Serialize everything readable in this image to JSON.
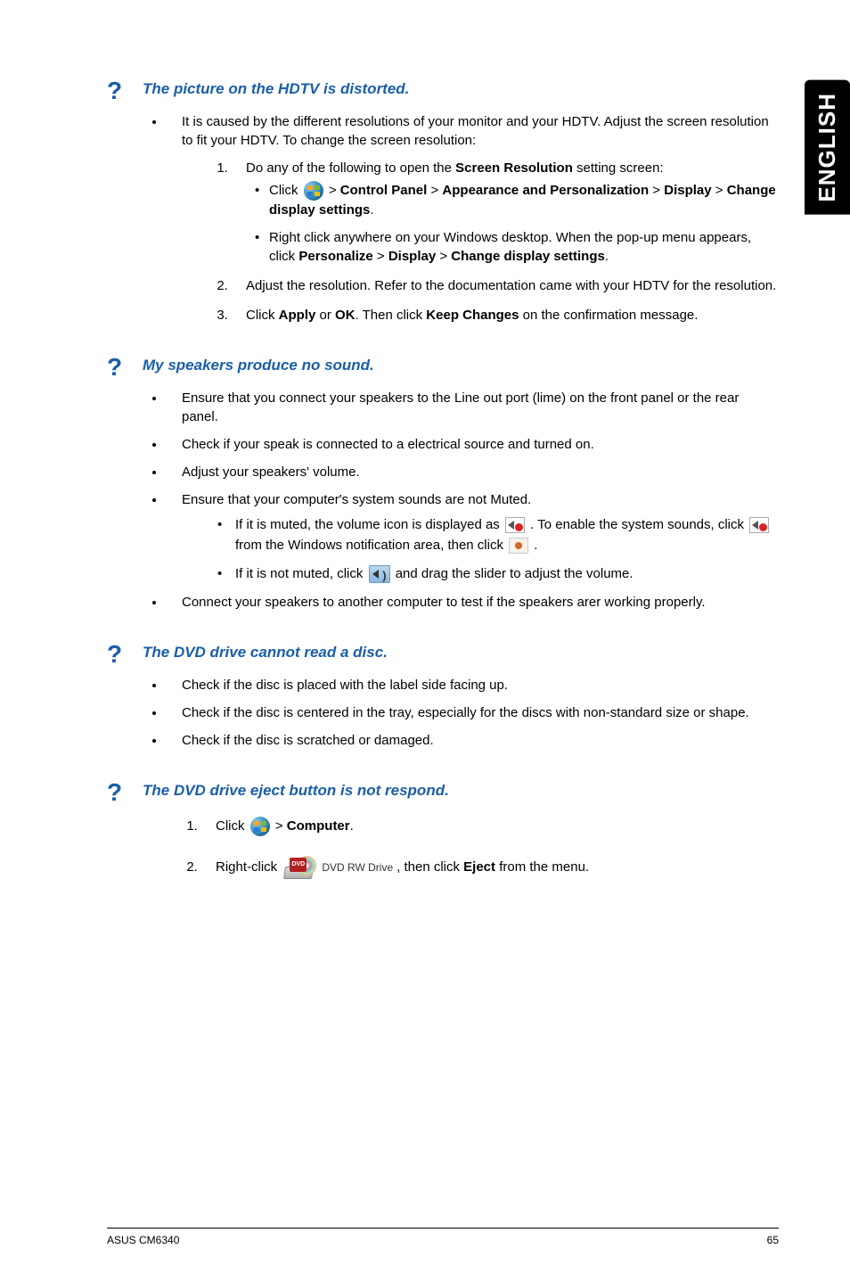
{
  "langTab": "ENGLISH",
  "sections": [
    {
      "title": "The picture on the HDTV is distorted.",
      "bullets": [
        {
          "text": "It is caused by the different resolutions of your monitor and your HDTV. Adjust the screen resolution to fit your HDTV. To change the screen resolution:",
          "steps": [
            {
              "lead": "Do any of the following to open the ",
              "bold1": "Screen Resolution",
              "tail": " setting screen:",
              "subs": [
                {
                  "t1": "Click ",
                  "b1": "Control Panel",
                  "gt1": " > ",
                  "b2": "Appearance and Personalization",
                  "gt2": " > ",
                  "b3": "Display",
                  "gt3": " > ",
                  "b4": "Change display settings",
                  "t2": ".",
                  "hasWinOrb": true
                },
                {
                  "t1": "Right click anywhere on your Windows desktop. When the pop-up menu appears, click ",
                  "b1": "Personalize",
                  "gt1": " > ",
                  "b2": "Display",
                  "gt2": " > ",
                  "b3": "Change display settings",
                  "t2": "."
                }
              ]
            },
            {
              "plain": "Adjust the resolution. Refer to the documentation came with your HDTV for the resolution."
            },
            {
              "t1": "Click ",
              "b1": "Apply",
              "mid": " or ",
              "b2": "OK",
              "t2": ". Then click ",
              "b3": "Keep Changes",
              "t3": " on the confirmation message."
            }
          ]
        }
      ]
    },
    {
      "title": "My speakers produce no sound.",
      "plainBullets": [
        "Ensure that you connect your speakers to the Line out port (lime) on the front panel or the rear panel.",
        "Check if your speak is connected to a electrical source and turned on.",
        "Adjust your speakers' volume."
      ],
      "mutedBullet": {
        "lead": "Ensure that your computer's system sounds are not Muted.",
        "c1a": "If it is muted, the volume icon is displayed as ",
        "c1b": " . To enable the system sounds, click ",
        "c1c": " from the Windows notification area, then click ",
        "c1d": " .",
        "c2a": "If it is not muted, click ",
        "c2b": " and drag the slider to adjust the volume."
      },
      "lastBullet": "Connect your speakers to another computer to test if the speakers arer working properly."
    },
    {
      "title": "The DVD drive cannot read a disc.",
      "plainBullets": [
        "Check if the disc is placed with the label side facing up.",
        "Check if the disc is centered in the tray, especially for the discs with non-standard size or shape.",
        "Check if the disc is scratched or damaged."
      ]
    },
    {
      "title": "The DVD drive eject button is not respond.",
      "steps": [
        {
          "t1": "Click ",
          "b1": "Computer",
          "t2": ".",
          "gt": " > ",
          "hasWinOrb": true
        },
        {
          "t1": "Right-click ",
          "t2": ", then click ",
          "b1": "Eject",
          "t3": " from the menu.",
          "hasDvd": true,
          "dvdBadge": "DVD",
          "dvdLabel": "DVD RW Drive"
        }
      ]
    }
  ],
  "footer": {
    "left": "ASUS CM6340",
    "right": "65"
  }
}
